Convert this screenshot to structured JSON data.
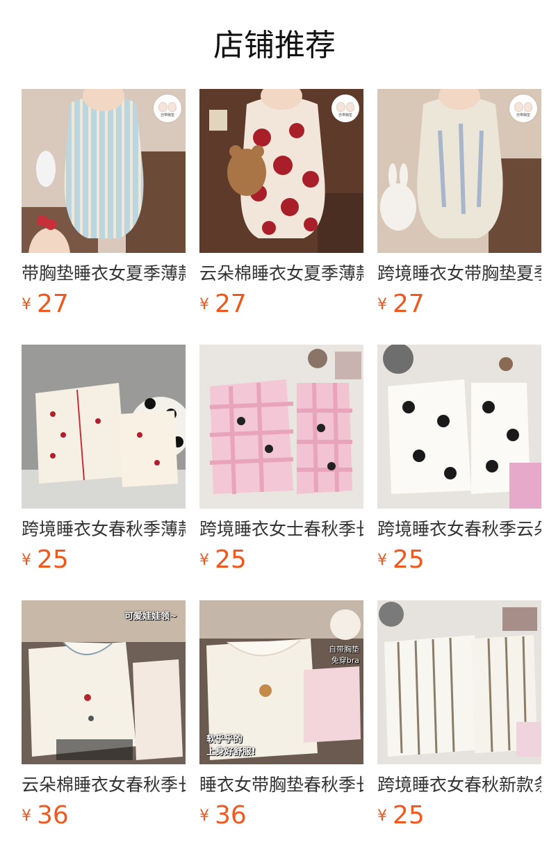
{
  "header": {
    "title": "店铺推荐"
  },
  "currency_symbol": "¥",
  "products": [
    {
      "name": "带胸垫睡衣女夏季薄款",
      "price": "27",
      "badge": "自带胸垫",
      "overlay": "",
      "overlay2": ""
    },
    {
      "name": "云朵棉睡衣女夏季薄款",
      "price": "27",
      "badge": "自带胸垫",
      "overlay": "",
      "overlay2": ""
    },
    {
      "name": "跨境睡衣女带胸垫夏季",
      "price": "27",
      "badge": "自带胸垫",
      "overlay": "",
      "overlay2": ""
    },
    {
      "name": "跨境睡衣女春秋季薄款",
      "price": "25",
      "badge": "",
      "overlay": "",
      "overlay2": ""
    },
    {
      "name": "跨境睡衣女士春秋季长袖",
      "price": "25",
      "badge": "",
      "overlay": "",
      "overlay2": ""
    },
    {
      "name": "跨境睡衣女春秋季云朵棉",
      "price": "25",
      "badge": "",
      "overlay": "",
      "overlay2": ""
    },
    {
      "name": "云朵棉睡衣女春秋季长袖",
      "price": "36",
      "badge": "",
      "overlay": "可爱娃娃领~",
      "overlay2": ""
    },
    {
      "name": "睡衣女带胸垫春秋季长袖",
      "price": "36",
      "badge": "",
      "overlay": "软乎乎的",
      "overlay2": "上身好舒服!",
      "overlay3": "自带胸垫",
      "overlay4": "免穿bra"
    },
    {
      "name": "跨境睡衣女春秋新款条纹",
      "price": "25",
      "badge": "",
      "overlay": "",
      "overlay2": ""
    }
  ],
  "colors": {
    "price": "#f0581e",
    "title": "#111111"
  }
}
